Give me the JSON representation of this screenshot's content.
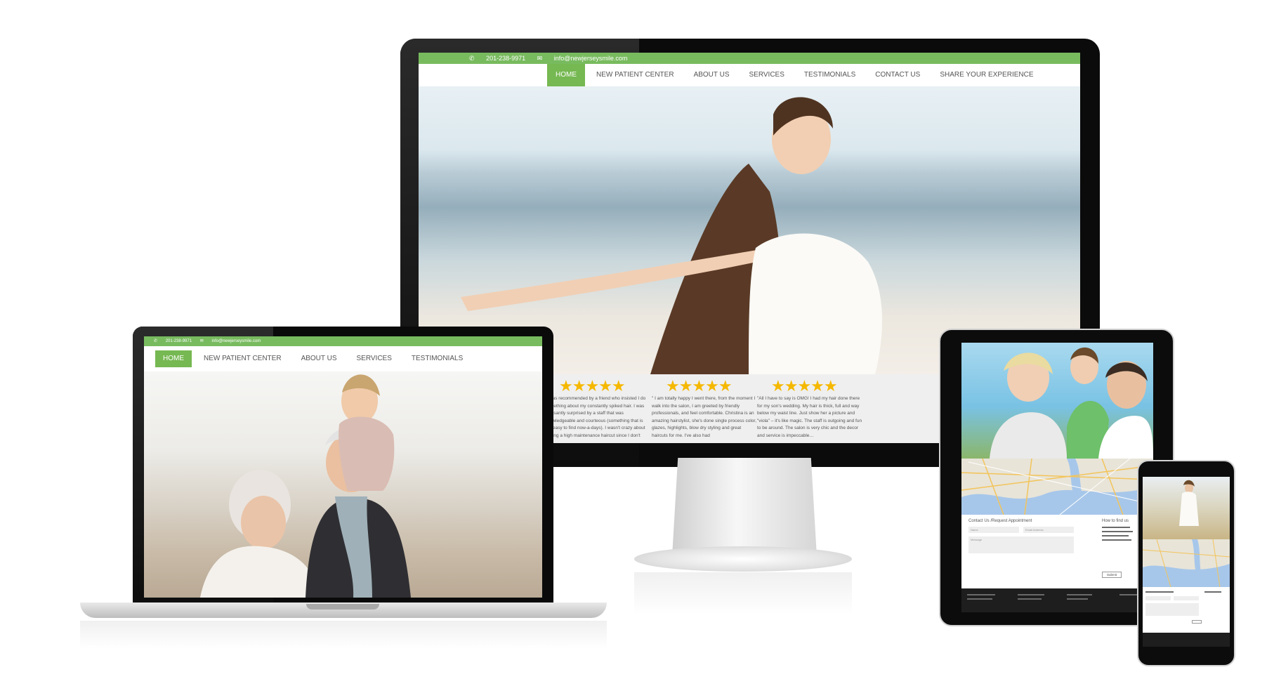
{
  "colors": {
    "brand_green": "#78bb5f",
    "active_nav": "#76b852",
    "star": "#f5b800",
    "device_black": "#0b0b0b"
  },
  "monitor": {
    "phone": "201-238-9971",
    "email": "info@newjerseysmile.com",
    "nav": [
      "HOME",
      "NEW PATIENT CENTER",
      "ABOUT US",
      "SERVICES",
      "TESTIMONIALS",
      "CONTACT US",
      "SHARE YOUR EXPERIENCE"
    ],
    "active_nav": "HOME",
    "testimonials": [
      {
        "stars": "★★★★★",
        "quote": "\"I was recommended by a friend who insisted I do something about my constantly spiked hair. I was pleasantly surprised by a staff that was knowledgeable and courteous (something that is not easy to find now-a-days). I wasn't crazy about getting a high maintenance haircut since I don't"
      },
      {
        "stars": "★★★★★",
        "quote": "\" I am totally happy I went there, from the moment I walk into the salon, I am greeted by friendly professionals, and feel comfortable. Christina is an amazing hairstylist, she's done single process color, glazes, highlights, blow dry styling and great haircuts for me. I've also had"
      },
      {
        "stars": "★★★★★",
        "quote": "\"All I have to say is OMG! I had my hair done there for my son's wedding. My hair is thick, full and way below my waist line. Just show her a picture and \"viola\" – it's like magic. The staff is outgoing and fun to be around. The salon is very chic and the decor and service is impeccable…"
      }
    ]
  },
  "laptop": {
    "phone": "201-238-9971",
    "email": "info@newjerseysmile.com",
    "nav": [
      "HOME",
      "NEW PATIENT CENTER",
      "ABOUT US",
      "SERVICES",
      "TESTIMONIALS"
    ],
    "active_nav": "HOME"
  },
  "tablet": {
    "contact_title": "Contact Us /Request Appointment",
    "find_title": "How to find us",
    "placeholders": [
      "Name",
      "Email Address",
      "Message"
    ],
    "submit_label": "Submit"
  },
  "icons": [
    "phone-icon",
    "envelope-icon",
    "star-icon"
  ]
}
